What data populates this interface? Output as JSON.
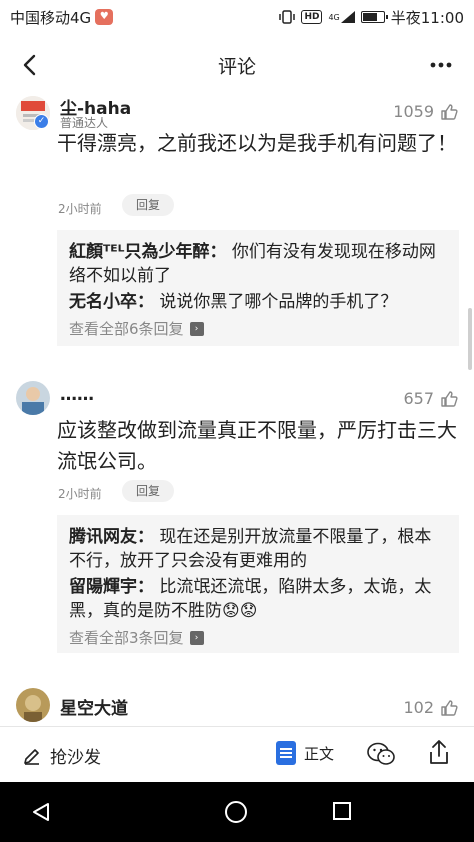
{
  "status_bar": {
    "carrier": "中国移动4G",
    "carrier_badge": "♥",
    "network": "4G",
    "hd": "HD",
    "time_label": "半夜11:00"
  },
  "header": {
    "title": "评论",
    "back_icon": "back-arrow-icon",
    "more_icon": "more-dots-icon"
  },
  "comments": [
    {
      "username": "尘-haha",
      "level": "普通达人",
      "verified": true,
      "likes": "1059",
      "text": "干得漂亮，之前我还以为是我手机有问题了！",
      "time": "2小时前",
      "reply_label": "回复",
      "replies": [
        {
          "user": "紅顏ᵀᴱᴸ只為少年醉",
          "sep": "：",
          "text": "你们有没有发现现在移动网络不如以前了"
        },
        {
          "user": "无名小卒",
          "sep": "：",
          "text": "说说你黑了哪个品牌的手机了？"
        }
      ],
      "view_all": "查看全部6条回复"
    },
    {
      "username": "……",
      "likes": "657",
      "text": "应该整改做到流量真正不限量，严厉打击三大流氓公司。",
      "time": "2小时前",
      "reply_label": "回复",
      "replies": [
        {
          "user": "腾讯网友",
          "sep": "：",
          "text": "现在还是别开放流量不限量了，根本不行，放开了只会没有更难用的"
        },
        {
          "user": "留陽輝宇",
          "sep": "：",
          "text": "比流氓还流氓，陷阱太多，太诡，太黑，真的是防不胜防😟😟"
        }
      ],
      "view_all": "查看全部3条回复"
    },
    {
      "username": "星空大道",
      "likes": "102"
    }
  ],
  "bottom_bar": {
    "sofa_label": "抢沙发",
    "article_label": "正文"
  },
  "colors": {
    "accent": "#2a6fe0",
    "verified": "#3b7ee8",
    "muted": "#888888"
  }
}
